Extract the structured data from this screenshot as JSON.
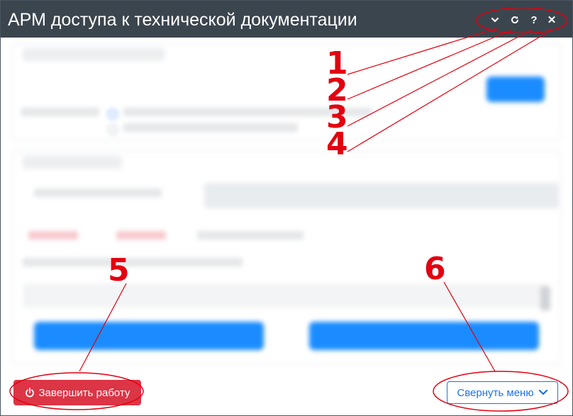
{
  "window": {
    "title": "АРМ доступа к технической документации",
    "controls": {
      "collapse_icon": "chevron-down-icon",
      "refresh_icon": "refresh-icon",
      "help_label": "?",
      "close_label": "✕"
    }
  },
  "footer": {
    "quit_label": "Завершить работу",
    "collapse_menu_label": "Свернуть меню"
  },
  "annotations": {
    "labels": [
      "1",
      "2",
      "3",
      "4",
      "5",
      "6"
    ],
    "color": "#e30010"
  },
  "colors": {
    "titlebar": "#3b454e",
    "quit_button": "#dc3545",
    "accent": "#1a73e8"
  }
}
